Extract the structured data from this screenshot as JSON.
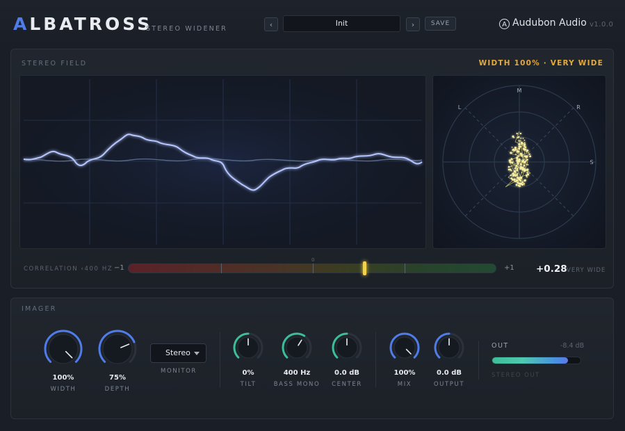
{
  "header": {
    "logo_accent": "A",
    "logo_rest": "LBATROSS",
    "subtitle": "STEREO WIDENER",
    "prev_label": "‹",
    "next_label": "›",
    "preset": "Init",
    "save_label": "SAVE",
    "brand_mark": "A",
    "brand": "Audubon Audio",
    "version": "v1.0.0"
  },
  "stereo_field": {
    "title": "STEREO FIELD",
    "width_label": "WIDTH 100% · VERY WIDE",
    "vector_labels": {
      "m": "M",
      "l": "L",
      "r": "R",
      "s": "S"
    }
  },
  "correlation": {
    "label": "CORRELATION ‹400 HZ",
    "min_label": "−1",
    "max_label": "+1",
    "center_label": "0",
    "value": 0.28,
    "value_text": "+0.28",
    "status": "VERY WIDE"
  },
  "imager": {
    "title": "IMAGER",
    "knobs": [
      {
        "id": "width",
        "value": "100%",
        "label": "WIDTH",
        "level": 1.0,
        "color": "#4f7ce8",
        "size": "large"
      },
      {
        "id": "depth",
        "value": "75%",
        "label": "DEPTH",
        "level": 0.75,
        "color": "#4f7ce8",
        "size": "large"
      },
      {
        "id": "tilt",
        "value": "0%",
        "label": "TILT",
        "level": 0.5,
        "color": "#3dbd9a",
        "size": "small"
      },
      {
        "id": "bass-mono",
        "value": "400 Hz",
        "label": "BASS MONO",
        "level": 0.62,
        "color": "#3dbd9a",
        "size": "small"
      },
      {
        "id": "center",
        "value": "0.0 dB",
        "label": "CENTER",
        "level": 0.5,
        "color": "#3dbd9a",
        "size": "small"
      },
      {
        "id": "mix",
        "value": "100%",
        "label": "MIX",
        "level": 1.0,
        "color": "#4f7ce8",
        "size": "small"
      },
      {
        "id": "output",
        "value": "0.0 dB",
        "label": "OUTPUT",
        "level": 0.5,
        "color": "#4f7ce8",
        "size": "small"
      }
    ],
    "monitor": {
      "value": "Stereo",
      "label": "MONITOR"
    },
    "out": {
      "label": "OUT",
      "db": "-8.4 dB",
      "level": 0.86,
      "meter_label": "STEREO OUT"
    }
  }
}
